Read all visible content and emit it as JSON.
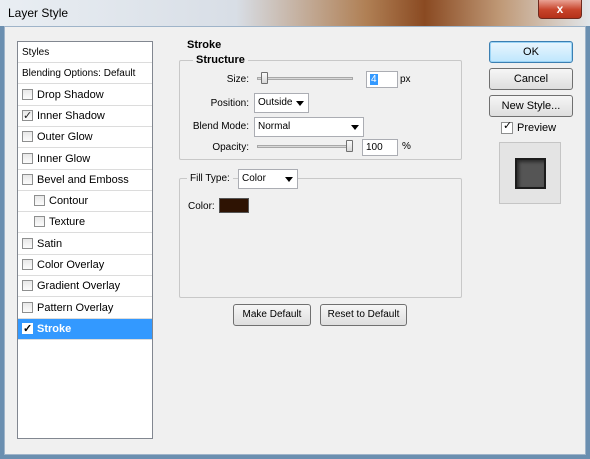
{
  "window": {
    "title": "Layer Style",
    "close_glyph": "x"
  },
  "styles_list": {
    "items": [
      {
        "label": "Styles",
        "has_checkbox": false,
        "checked": false,
        "selected": false,
        "indent": false
      },
      {
        "label": "Blending Options: Default",
        "has_checkbox": false,
        "checked": false,
        "selected": false,
        "indent": false
      },
      {
        "label": "Drop Shadow",
        "has_checkbox": true,
        "checked": false,
        "selected": false,
        "indent": false
      },
      {
        "label": "Inner Shadow",
        "has_checkbox": true,
        "checked": true,
        "selected": false,
        "indent": false
      },
      {
        "label": "Outer Glow",
        "has_checkbox": true,
        "checked": false,
        "selected": false,
        "indent": false
      },
      {
        "label": "Inner Glow",
        "has_checkbox": true,
        "checked": false,
        "selected": false,
        "indent": false
      },
      {
        "label": "Bevel and Emboss",
        "has_checkbox": true,
        "checked": false,
        "selected": false,
        "indent": false
      },
      {
        "label": "Contour",
        "has_checkbox": true,
        "checked": false,
        "selected": false,
        "indent": true
      },
      {
        "label": "Texture",
        "has_checkbox": true,
        "checked": false,
        "selected": false,
        "indent": true
      },
      {
        "label": "Satin",
        "has_checkbox": true,
        "checked": false,
        "selected": false,
        "indent": false
      },
      {
        "label": "Color Overlay",
        "has_checkbox": true,
        "checked": false,
        "selected": false,
        "indent": false
      },
      {
        "label": "Gradient Overlay",
        "has_checkbox": true,
        "checked": false,
        "selected": false,
        "indent": false
      },
      {
        "label": "Pattern Overlay",
        "has_checkbox": true,
        "checked": false,
        "selected": false,
        "indent": false
      },
      {
        "label": "Stroke",
        "has_checkbox": true,
        "checked": true,
        "selected": true,
        "indent": false
      }
    ]
  },
  "stroke": {
    "section_title": "Stroke",
    "structure_title": "Structure",
    "size": {
      "label": "Size:",
      "value": "4",
      "unit": "px",
      "slider_fraction": 0.04
    },
    "position": {
      "label": "Position:",
      "value": "Outside"
    },
    "blend_mode": {
      "label": "Blend Mode:",
      "value": "Normal"
    },
    "opacity": {
      "label": "Opacity:",
      "value": "100",
      "unit": "%",
      "slider_fraction": 1.0
    },
    "fill_type": {
      "label": "Fill Type:",
      "value": "Color"
    },
    "color": {
      "label": "Color:",
      "swatch_color": "#2e1303"
    },
    "make_default": "Make Default",
    "reset_default": "Reset to Default"
  },
  "actions": {
    "ok": "OK",
    "cancel": "Cancel",
    "new_style": "New Style...",
    "preview_label": "Preview",
    "preview_checked": true
  }
}
